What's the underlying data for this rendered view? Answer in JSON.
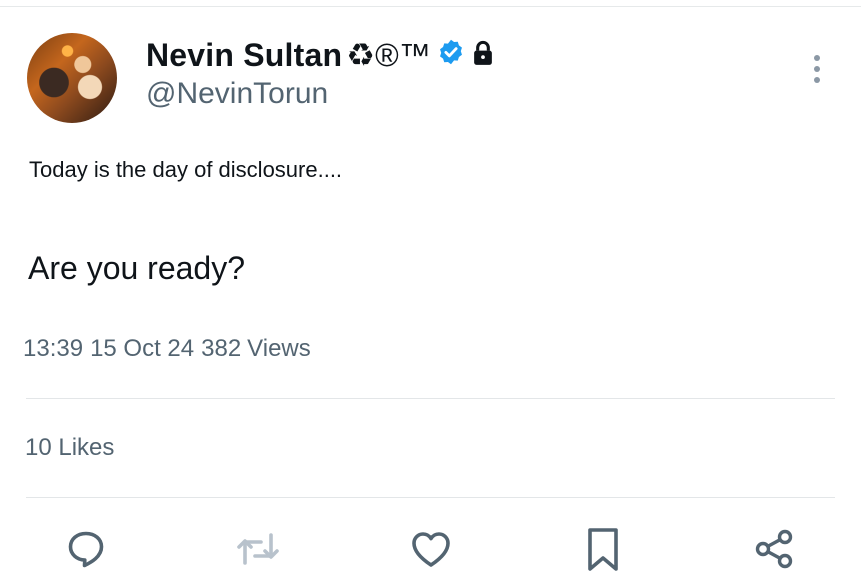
{
  "tweet": {
    "author": {
      "display_name": "Nevin Sultan",
      "name_suffix": "♻®™",
      "handle": "@NevinTorun",
      "verified_badge": "verified-badge-icon",
      "protected_badge": "lock-icon"
    },
    "text_line1": "Today is the day of disclosure....",
    "text_line2": "Are you ready?",
    "time": "13:39",
    "date": "15 Oct 24",
    "views_count": "382",
    "views_label": "Views",
    "likes_count": "10",
    "likes_label": "Likes"
  },
  "actions": [
    {
      "icon": "reply-icon"
    },
    {
      "icon": "retweet-icon"
    },
    {
      "icon": "like-icon"
    },
    {
      "icon": "bookmark-icon"
    },
    {
      "icon": "share-icon"
    }
  ],
  "colors": {
    "primary_text": "#0f1419",
    "secondary_text": "#536471",
    "verified_blue": "#1d9bf0",
    "divider": "#e3e6e8"
  }
}
